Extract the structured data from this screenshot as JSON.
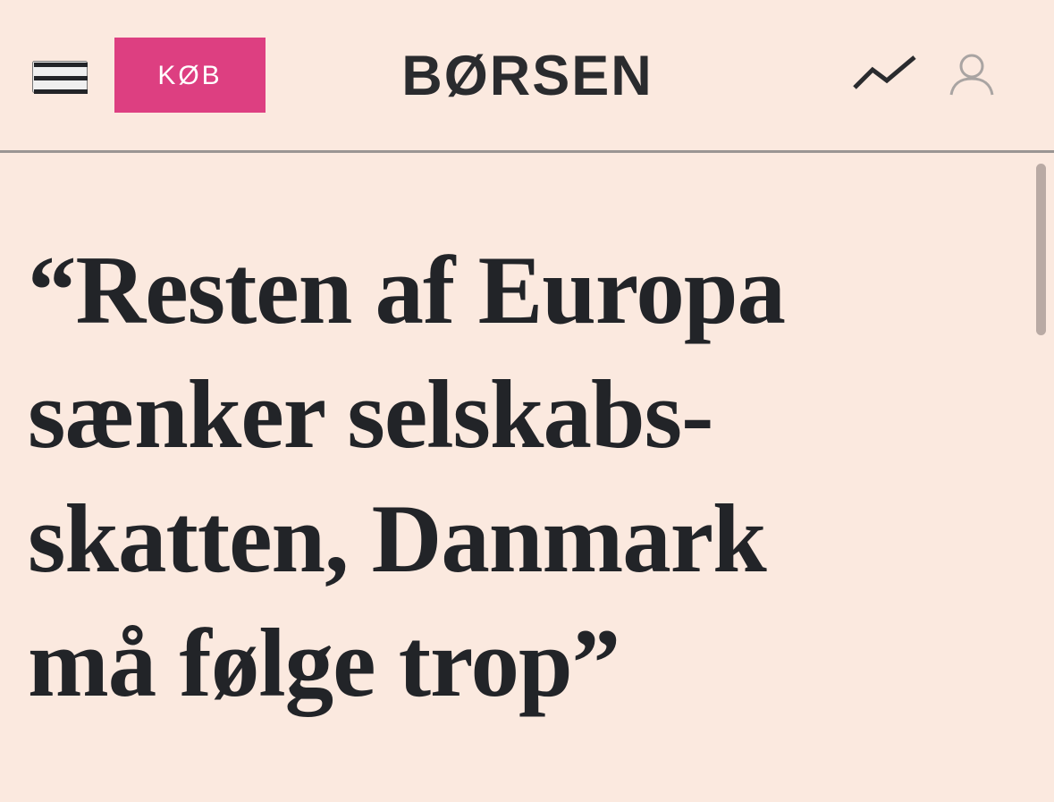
{
  "header": {
    "buy_label": "KØB",
    "brand": "BØRSEN",
    "menu_icon": "hamburger-menu-icon",
    "market_icon": "trend-line-icon",
    "profile_icon": "user-profile-icon"
  },
  "article": {
    "headline_lines": [
      "“Resten af Europa",
      "sænker selskabs-",
      "skatten, Danmark",
      "må følge trop”"
    ]
  },
  "colors": {
    "background": "#fbe9df",
    "accent": "#dd3f81",
    "text": "#222428",
    "divider": "#9a9593"
  }
}
